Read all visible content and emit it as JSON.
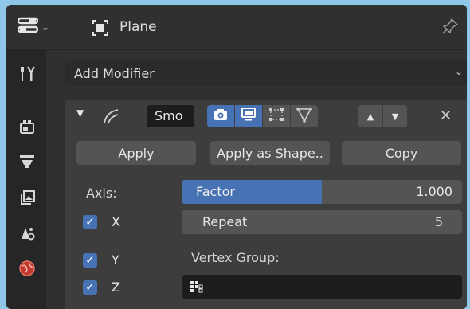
{
  "header": {
    "object_name": "Plane",
    "icons": [
      "properties-editor-icon",
      "chevron-down-icon",
      "mesh-object-icon",
      "pin-icon"
    ]
  },
  "tabs": [
    {
      "name": "tool",
      "icon": "tool-icon",
      "active": false
    },
    {
      "name": "render",
      "icon": "render-icon",
      "active": false
    },
    {
      "name": "output",
      "icon": "output-icon",
      "active": false
    },
    {
      "name": "view-layer",
      "icon": "view-layer-icon",
      "active": false
    },
    {
      "name": "scene",
      "icon": "scene-icon",
      "active": false
    },
    {
      "name": "world",
      "icon": "world-icon",
      "active": false
    }
  ],
  "add_modifier": {
    "label": "Add Modifier"
  },
  "modifier": {
    "name": "Smo",
    "icons": [
      "collapse-icon",
      "smooth-modifier-icon",
      "realtime-camera-icon",
      "viewport-icon",
      "editmode-icon",
      "cage-icon",
      "move-up-icon",
      "move-down-icon",
      "remove-icon"
    ],
    "buttons": {
      "apply": "Apply",
      "apply_as_shape": "Apply as Shape..",
      "copy": "Copy"
    },
    "axis_label": "Axis:",
    "axes": [
      {
        "label": "X",
        "checked": true
      },
      {
        "label": "Y",
        "checked": true
      },
      {
        "label": "Z",
        "checked": true
      }
    ],
    "factor": {
      "label": "Factor",
      "value": "1.000",
      "fill_fraction": 0.5
    },
    "repeat": {
      "label": "Repeat",
      "value": "5"
    },
    "vertex_group": {
      "label": "Vertex Group:",
      "value": ""
    }
  },
  "colors": {
    "accent": "#4772b3",
    "panel_bg": "#3d3d3d",
    "window_bg": "#303030",
    "field_bg": "#1d1d1d",
    "button_bg": "#545454"
  }
}
